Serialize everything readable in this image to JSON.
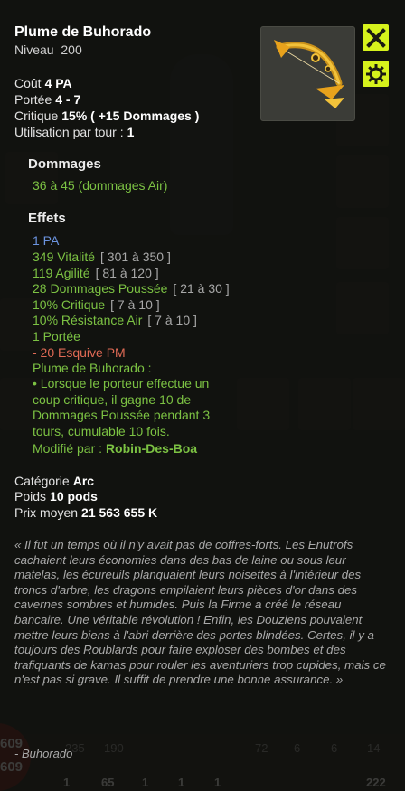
{
  "item": {
    "name": "Plume de Buhorado",
    "level_label": "Niveau",
    "level_value": "200"
  },
  "stats": [
    {
      "label": "Coût",
      "value": "4 PA"
    },
    {
      "label": "Portée",
      "value": "4 - 7"
    },
    {
      "label": "Critique",
      "value": "15% ( +15 Dommages )"
    },
    {
      "label": "Utilisation par tour :",
      "value": "1"
    }
  ],
  "damage": {
    "header": "Dommages",
    "line": "36 à 45 (dommages Air)"
  },
  "effects": {
    "header": "Effets",
    "pa": "1 PA",
    "lines": [
      {
        "text": "349 Vitalité",
        "range": "[ 301 à 350 ]"
      },
      {
        "text": "119 Agilité",
        "range": "[ 81 à 120 ]"
      },
      {
        "text": "28 Dommages Poussée",
        "range": "[ 21 à 30 ]"
      },
      {
        "text": "10% Critique",
        "range": "[ 7 à 10 ]"
      },
      {
        "text": "10% Résistance Air",
        "range": "[ 7 à 10 ]"
      },
      {
        "text": "1 Portée",
        "range": ""
      }
    ],
    "negative": "- 20 Esquive PM",
    "set_title": "Plume de Buhorado :",
    "set_desc": "• Lorsque le porteur effectue un coup critique, il gagne 10 de Dommages Poussée pendant 3 tours, cumulable 10 fois.",
    "modified_label": "Modifié par :",
    "modified_by": "Robin-Des-Boa"
  },
  "info": [
    {
      "label": "Catégorie",
      "value": "Arc"
    },
    {
      "label": "Poids",
      "value": "10 pods"
    },
    {
      "label": "Prix moyen",
      "value": "21 563 655 K"
    }
  ],
  "lore": "« Il fut un temps où il n'y avait pas de coffres-forts. Les Enutrofs cachaient leurs économies dans des bas de laine ou sous leur matelas, les écureuils planquaient leurs noisettes à l'intérieur des troncs d'arbre, les dragons empilaient leurs pièces d'or dans des cavernes sombres et humides. Puis la Firme a créé le réseau bancaire. Une véritable révolution ! Enfin, les Douziens pouvaient mettre leurs biens à l'abri derrière des portes blindées. Certes, il y a toujours des Roublards pour faire exploser des bombes et des trafiquants de kamas pour rouler les aventuriers trop cupides, mais ce n'est pas si grave. Il suffit de prendre une bonne assurance. »",
  "signature": "- Buhorado",
  "background": {
    "hp_top": "609",
    "hp_bottom": "609",
    "slot_counts": [
      "235",
      "190",
      "72",
      "6",
      "6",
      "14"
    ],
    "bottom_counts": [
      "1",
      "65",
      "1",
      "1",
      "1",
      "222"
    ]
  },
  "icons": {
    "close": "close-x-icon",
    "settings": "gear-icon",
    "item_image": "golden-bow-icon"
  },
  "colors": {
    "accent_button": "#d6f21c",
    "effect_green": "#7cc243",
    "pa_blue": "#6c94e0",
    "negative_red": "#e06a55"
  }
}
